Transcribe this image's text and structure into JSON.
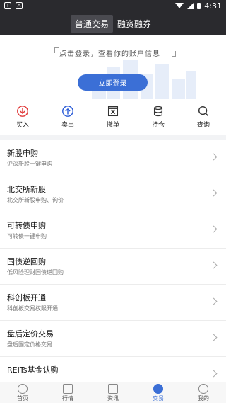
{
  "status_bar": {
    "time": "4:31"
  },
  "top_tabs": [
    {
      "label": "普通交易"
    },
    {
      "label": "融资融券"
    }
  ],
  "login": {
    "tip": "点击登录，查看你的账户信息",
    "button_label": "立即登录"
  },
  "actions": [
    {
      "label": "买入",
      "icon": "buy-icon"
    },
    {
      "label": "卖出",
      "icon": "sell-icon"
    },
    {
      "label": "撤单",
      "icon": "cancel-order-icon"
    },
    {
      "label": "持仓",
      "icon": "holdings-icon"
    },
    {
      "label": "查询",
      "icon": "search-icon"
    }
  ],
  "list_items": [
    {
      "title": "新股申购",
      "subtitle": "沪深新股一键申购"
    },
    {
      "title": "北交所新股",
      "subtitle": "北交所新股申购、询价"
    },
    {
      "title": "可转债申购",
      "subtitle": "可转债一键申购"
    },
    {
      "title": "国债逆回购",
      "subtitle": "低风险理财国债逆回购"
    },
    {
      "title": "科创板开通",
      "subtitle": "科创板交易权限开通"
    },
    {
      "title": "盘后定价交易",
      "subtitle": "盘后固定价格交易"
    },
    {
      "title": "REITs基金认购",
      "subtitle": ""
    }
  ],
  "bottom_tabs": [
    {
      "label": "首页",
      "icon": "home-icon"
    },
    {
      "label": "行情",
      "icon": "market-icon"
    },
    {
      "label": "资讯",
      "icon": "news-icon"
    },
    {
      "label": "交易",
      "icon": "trade-icon"
    },
    {
      "label": "我的",
      "icon": "profile-icon"
    }
  ],
  "colors": {
    "accent": "#3b6fd6",
    "buy": "#e03a3a",
    "sell": "#2a5bd7",
    "header": "#2a2a2e"
  }
}
